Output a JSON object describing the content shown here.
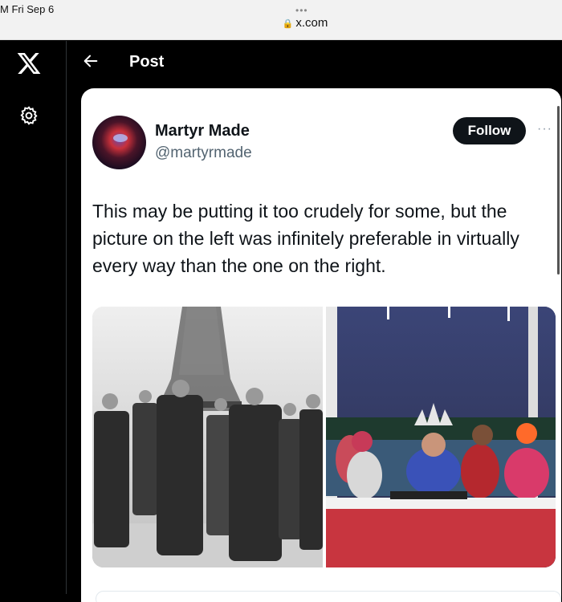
{
  "statusbar": {
    "time": "M   Fri Sep 6",
    "url": "x.com",
    "dots": "•••"
  },
  "header": {
    "title": "Post"
  },
  "post": {
    "author_name": "Martyr Made",
    "handle": "@martyrmade",
    "follow_label": "Follow",
    "more_label": "···",
    "text": "This may be putting it too crudely for some, but the picture on the left was infinitely preferable in virtually every way than the one on the right."
  },
  "icons": {
    "logo": "x-logo-icon",
    "settings": "gear-icon",
    "back": "arrow-left-icon",
    "lock": "lock-icon"
  },
  "colors": {
    "follow_bg": "#0f1419",
    "handle": "#536471",
    "background": "#000000"
  }
}
